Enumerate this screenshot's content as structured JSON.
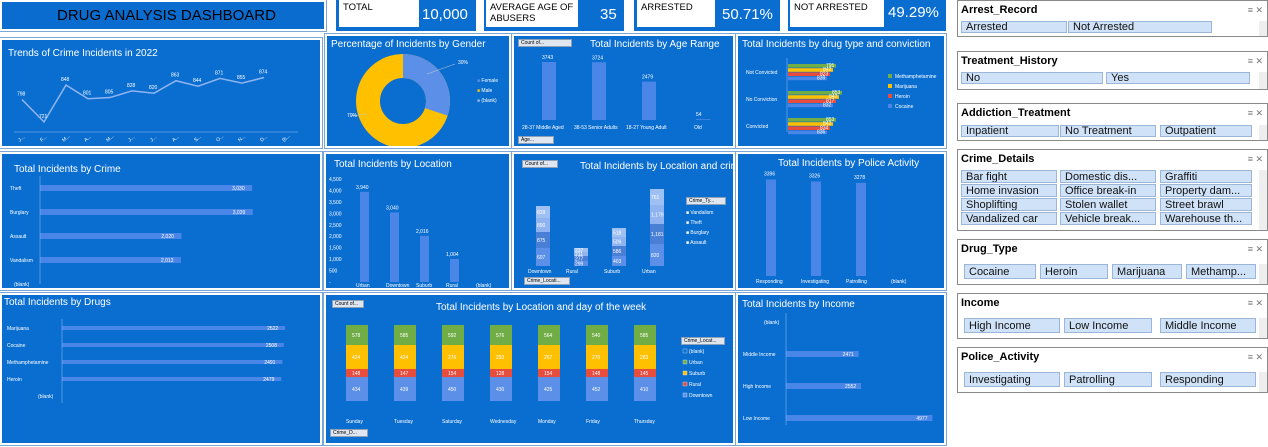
{
  "title": "DRUG ANALYSIS DASHBOARD",
  "kpis": [
    {
      "label": "TOTAL",
      "value": "10,000"
    },
    {
      "label": "AVERAGE AGE OF ABUSERS",
      "value": "35"
    },
    {
      "label": "ARRESTED",
      "value": "50.71%"
    },
    {
      "label": "NOT ARRESTED",
      "value": "49.29%"
    }
  ],
  "charts": {
    "trend": {
      "title": "Trends of Crime Incidents in 2022",
      "values": [
        798,
        721,
        848,
        801,
        805,
        828,
        820,
        863,
        844,
        871,
        855,
        874
      ],
      "xticks": [
        "J...",
        "F...",
        "M...",
        "A...",
        "M...",
        "J...",
        "J...",
        "A...",
        "S...",
        "O...",
        "N...",
        "D...",
        "(b..."
      ]
    },
    "gender": {
      "title": "Percentage of Incidents by Gender",
      "label_small": "30%",
      "label_large": "70%",
      "legend": [
        "Female",
        "Male",
        "(blank)"
      ]
    },
    "age": {
      "title": "Total Incidents by Age Range",
      "filter_top": "Count of...",
      "filter_bottom": "Age...",
      "categories": [
        "28-37 Middle Aged",
        "38-53 Senior Adults",
        "18-27 Young Adult",
        "Old"
      ],
      "values": [
        3743,
        3724,
        2479,
        54
      ]
    },
    "drug_conv": {
      "title": "Total Incidents by drug type and conviction",
      "categories": [
        "Not Convicted",
        "No Conviction",
        "Convicted"
      ],
      "legend": [
        "Methamphetamine",
        "Marijuana",
        "Heroin",
        "Cocaine"
      ],
      "rows": [
        [
          "795",
          "842",
          "823",
          "839"
        ],
        [
          "853",
          "842",
          "817",
          "832"
        ],
        [
          "853",
          "842",
          "834",
          "836"
        ]
      ]
    },
    "crime": {
      "title": "Total Incidents by Crime",
      "categories": [
        "Theft",
        "Burglary",
        "Assault",
        "Vandalism",
        "(blank)"
      ],
      "values": [
        3030,
        3039,
        2020,
        2013
      ]
    },
    "location": {
      "title": "Total Incidents by Location",
      "categories": [
        "Urban",
        "Downtown",
        "Suburb",
        "Rural",
        "(blank)"
      ],
      "values": [
        3940,
        3040,
        2016,
        1004
      ],
      "yticks": [
        "4,500",
        "4,000",
        "3,500",
        "3,000",
        "2,500",
        "2,000",
        "1,500",
        "1,000",
        "500",
        "-"
      ]
    },
    "loc_crime": {
      "title": "Total Incidents by Location and crime",
      "filter_top": "Count of...",
      "filter_bottom": "Crime_Locati...",
      "filter_legend": "Crime_Ty...",
      "categories": [
        "Downtown",
        "Rural",
        "Suburb",
        "Urban"
      ],
      "legend": [
        "Vandalism",
        "Theft",
        "Burglary",
        "Assault"
      ],
      "labels": [
        [
          "607",
          "875",
          "890",
          "828"
        ],
        [
          "299",
          "277",
          "211",
          "237"
        ],
        [
          "403",
          "586",
          "509",
          "518"
        ],
        [
          "820",
          "1,181",
          "1,179",
          "761"
        ]
      ]
    },
    "police": {
      "title": "Total Incidents by Police Activity",
      "categories": [
        "Responding",
        "Investigating",
        "Patrolling",
        "(blank)"
      ],
      "values": [
        3396,
        3326,
        3278
      ]
    },
    "drugs": {
      "title": "Total Incidents by Drugs",
      "categories": [
        "Marijuana",
        "Cocaine",
        "Methamphetamine",
        "Heroin",
        "(blank)"
      ],
      "values": [
        2522,
        2508,
        2491,
        2479
      ]
    },
    "loc_day": {
      "title": "Total Incidents by Location and day of the week",
      "filter_top": "Count of...",
      "filter_bottom": "Crime_D...",
      "filter_legend": "Crime_Locat...",
      "categories": [
        "Sunday",
        "Tuesday",
        "Saturday",
        "Wednesday",
        "Monday",
        "Friday",
        "Thursday"
      ],
      "legend": [
        "(blank)",
        "Urban",
        "Suburb",
        "Rural",
        "Downtown"
      ],
      "labels": [
        [
          "578",
          "424",
          "148",
          "434"
        ],
        [
          "585",
          "424",
          "147",
          "439"
        ],
        [
          "592",
          "276",
          "154",
          "450"
        ],
        [
          "576",
          "293",
          "128",
          "430"
        ],
        [
          "564",
          "267",
          "154",
          "425"
        ],
        [
          "540",
          "270",
          "148",
          "452"
        ],
        [
          "585",
          "283",
          "145",
          "410"
        ]
      ]
    },
    "income": {
      "title": "Total Incidents by Income",
      "categories": [
        "(blank)",
        "Middle Income",
        "High Income",
        "Low Income"
      ],
      "values": [
        null,
        2471,
        2552,
        4977
      ]
    }
  },
  "slicers": [
    {
      "title": "Arrest_Record",
      "items": [
        "Arrested",
        "Not Arrested"
      ]
    },
    {
      "title": "Treatment_History",
      "items": [
        "No",
        "Yes"
      ]
    },
    {
      "title": "Addiction_Treatment",
      "items": [
        "Inpatient",
        "No Treatment",
        "Outpatient"
      ]
    },
    {
      "title": "Crime_Details",
      "items": [
        "Bar fight",
        "Domestic dis...",
        "Graffiti",
        "Home invasion",
        "Office break-in",
        "Property dam...",
        "Shoplifting",
        "Stolen wallet",
        "Street brawl",
        "Vandalized car",
        "Vehicle break...",
        "Warehouse th..."
      ]
    },
    {
      "title": "Drug_Type",
      "items": [
        "Cocaine",
        "Heroin",
        "Marijuana",
        "Methamp..."
      ]
    },
    {
      "title": "Income",
      "items": [
        "High Income",
        "Low Income",
        "Middle Income"
      ]
    },
    {
      "title": "Police_Activity",
      "items": [
        "Investigating",
        "Patrolling",
        "Responding"
      ]
    }
  ],
  "colors": {
    "panel": "#0a6ed1",
    "bar": "#4a86e8",
    "male": "#ffc000",
    "female": "#5b8fe8",
    "green": "#70ad47",
    "orange": "#ffc000",
    "red": "#e84c3d",
    "light": "#8fb4f0"
  }
}
